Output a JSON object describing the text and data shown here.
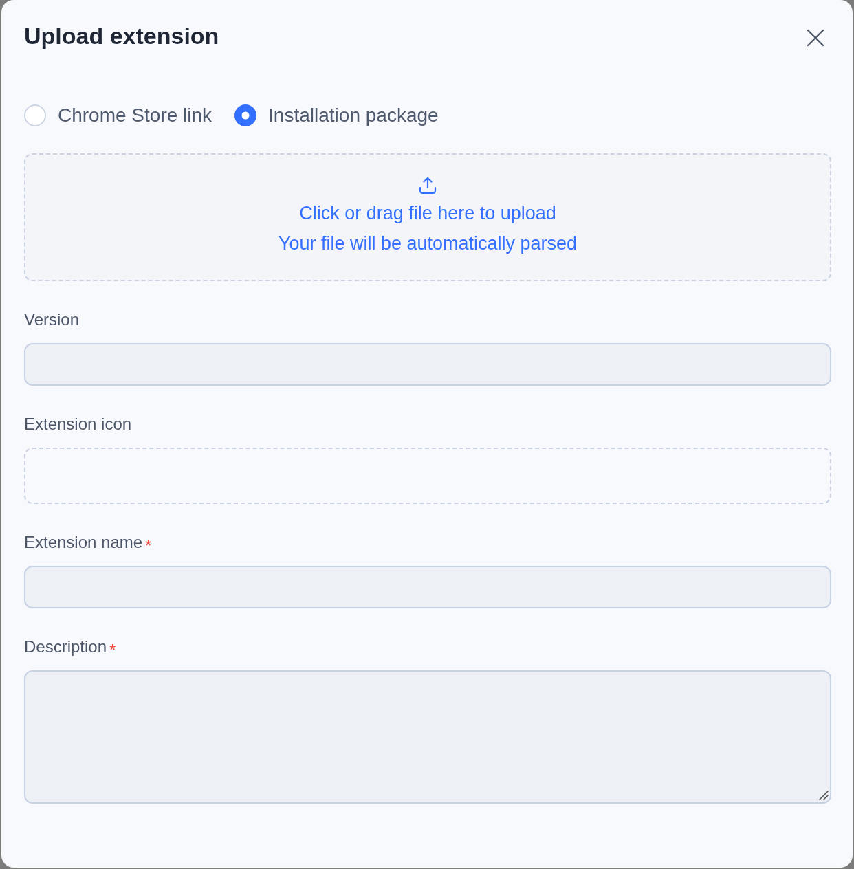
{
  "dialog": {
    "title": "Upload extension"
  },
  "source_options": [
    {
      "label": "Chrome Store link",
      "selected": false
    },
    {
      "label": "Installation package",
      "selected": true
    }
  ],
  "upload_zone": {
    "title": "Click or drag file here to upload",
    "hint": "Your file will be automatically parsed"
  },
  "fields": [
    {
      "kind": "input",
      "label": "Version"
    },
    {
      "kind": "upload",
      "label": "Extension icon"
    },
    {
      "kind": "input",
      "label": "Extension name",
      "required_mark": "*"
    },
    {
      "kind": "textarea",
      "label": "Description",
      "required_mark": "*"
    }
  ]
}
